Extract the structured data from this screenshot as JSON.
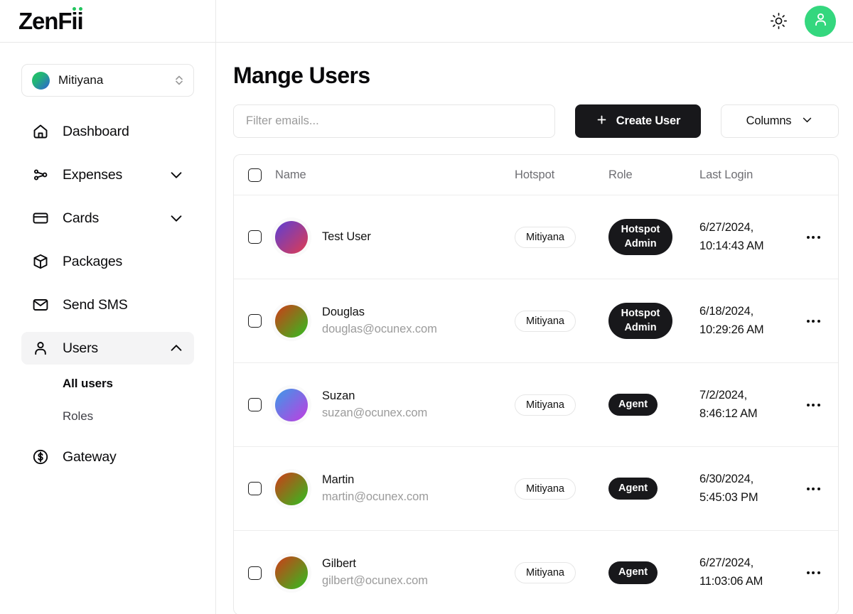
{
  "brand": {
    "name": "ZenFii",
    "accent_color": "#22c55e"
  },
  "sidebar": {
    "org": {
      "name": "Mitiyana",
      "avatar_gradient": "#22c55e -> #2f5fd8"
    },
    "items": [
      {
        "label": "Dashboard",
        "icon": "home-icon",
        "expandable": false
      },
      {
        "label": "Expenses",
        "icon": "network-icon",
        "expandable": true,
        "expanded": false
      },
      {
        "label": "Cards",
        "icon": "credit-card-icon",
        "expandable": true,
        "expanded": false
      },
      {
        "label": "Packages",
        "icon": "package-icon",
        "expandable": false
      },
      {
        "label": "Send SMS",
        "icon": "envelope-icon",
        "expandable": false
      },
      {
        "label": "Users",
        "icon": "user-icon",
        "expandable": true,
        "expanded": true,
        "active": true
      },
      {
        "label": "Gateway",
        "icon": "dollar-circle-icon",
        "expandable": false
      }
    ],
    "users_subitems": [
      {
        "label": "All users",
        "current": true
      },
      {
        "label": "Roles",
        "current": false
      }
    ]
  },
  "topbar": {
    "theme_toggle_icon": "sun-icon",
    "avatar_icon": "user-icon",
    "avatar_color": "#34d77e"
  },
  "main": {
    "title": "Mange Users",
    "filter": {
      "value": "",
      "placeholder": "Filter emails..."
    },
    "create_user_label": "Create User",
    "create_user_icon": "plus-icon",
    "columns_label": "Columns",
    "columns_icon": "chevron-down-icon"
  },
  "table": {
    "headers": [
      "Name",
      "Hotspot",
      "Role",
      "Last Login"
    ],
    "select_all_checked": false,
    "rows": [
      {
        "checked": false,
        "name": "Test User",
        "email": "",
        "avatar_gradient": "#5b3fd6 -> #e13b4f",
        "hotspot": "Mitiyana",
        "role": "Hotspot Admin",
        "last_login": "6/27/2024, 10:14:43 AM"
      },
      {
        "checked": false,
        "name": "Douglas",
        "email": "douglas@ocunex.com",
        "avatar_gradient": "#d03a18 -> #2fbf20",
        "hotspot": "Mitiyana",
        "role": "Hotspot Admin",
        "last_login": "6/18/2024, 10:29:26 AM"
      },
      {
        "checked": false,
        "name": "Suzan",
        "email": "suzan@ocunex.com",
        "avatar_gradient": "#3b9ae8 -> #c13ce0",
        "hotspot": "Mitiyana",
        "role": "Agent",
        "last_login": "7/2/2024, 8:46:12 AM"
      },
      {
        "checked": false,
        "name": "Martin",
        "email": "martin@ocunex.com",
        "avatar_gradient": "#d03a18 -> #2fbf20",
        "hotspot": "Mitiyana",
        "role": "Agent",
        "last_login": "6/30/2024, 5:45:03 PM"
      },
      {
        "checked": false,
        "name": "Gilbert",
        "email": "gilbert@ocunex.com",
        "avatar_gradient": "#d03a18 -> #2fbf20",
        "hotspot": "Mitiyana",
        "role": "Agent",
        "last_login": "6/27/2024, 11:03:06 AM"
      }
    ],
    "row_menu_icon": "more-horizontal-icon"
  }
}
